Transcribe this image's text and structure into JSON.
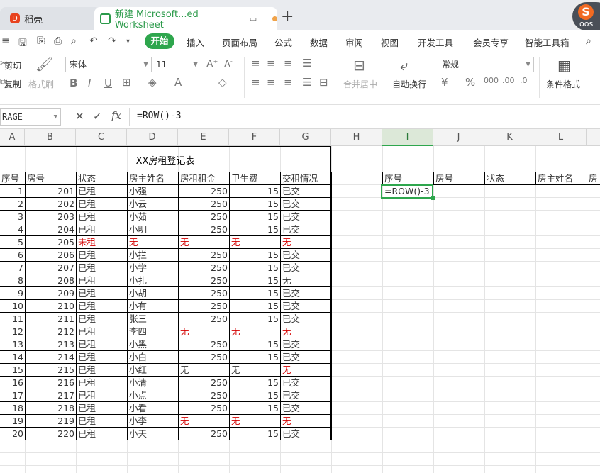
{
  "tabs": [
    {
      "label": "稻壳",
      "active": false
    },
    {
      "label": "新建 Microsoft...ed Worksheet",
      "active": true
    }
  ],
  "menu": {
    "items": [
      "开始",
      "插入",
      "页面布局",
      "公式",
      "数据",
      "审阅",
      "视图",
      "开发工具",
      "会员专享",
      "智能工具箱"
    ],
    "active": "开始"
  },
  "ribbon": {
    "cut": "剪切",
    "paste_fmt": "格式刷",
    "copy": "复制",
    "font_name": "宋体",
    "font_size": "11",
    "merge": "合并居中",
    "wrap": "自动换行",
    "number_format": "常规",
    "cond_format": "条件格式"
  },
  "formula_bar": {
    "name_box": "RAGE",
    "fx": "fx",
    "formula": "=ROW()-3"
  },
  "columns": [
    "A",
    "B",
    "C",
    "D",
    "E",
    "F",
    "G",
    "H",
    "I",
    "J",
    "K",
    "L"
  ],
  "active_column": "I",
  "sheet": {
    "title": "XX房租登记表",
    "headers": [
      "序号",
      "房号",
      "状态",
      "房主姓名",
      "房租租金",
      "卫生费",
      "交租情况"
    ],
    "rows": [
      [
        "1",
        "201",
        "已租",
        "小强",
        "250",
        "15",
        "已交"
      ],
      [
        "2",
        "202",
        "已租",
        "小云",
        "250",
        "15",
        "已交"
      ],
      [
        "3",
        "203",
        "已租",
        "小茹",
        "250",
        "15",
        "已交"
      ],
      [
        "4",
        "204",
        "已租",
        "小明",
        "250",
        "15",
        "已交"
      ],
      [
        "5",
        "205",
        "未租",
        "无",
        "无",
        "无",
        "无"
      ],
      [
        "6",
        "206",
        "已租",
        "小拦",
        "250",
        "15",
        "已交"
      ],
      [
        "7",
        "207",
        "已租",
        "小学",
        "250",
        "15",
        "已交"
      ],
      [
        "8",
        "208",
        "已租",
        "小扎",
        "250",
        "15",
        "无"
      ],
      [
        "9",
        "209",
        "已租",
        "小胡",
        "250",
        "15",
        "已交"
      ],
      [
        "10",
        "210",
        "已租",
        "小有",
        "250",
        "15",
        "已交"
      ],
      [
        "11",
        "211",
        "已租",
        "张三",
        "250",
        "15",
        "已交"
      ],
      [
        "12",
        "212",
        "已租",
        "李四",
        "无",
        "无",
        "无"
      ],
      [
        "13",
        "213",
        "已租",
        "小黑",
        "250",
        "15",
        "已交"
      ],
      [
        "14",
        "214",
        "已租",
        "小白",
        "250",
        "15",
        "已交"
      ],
      [
        "15",
        "215",
        "已租",
        "小红",
        "无",
        "无",
        "无"
      ],
      [
        "16",
        "216",
        "已租",
        "小清",
        "250",
        "15",
        "已交"
      ],
      [
        "17",
        "217",
        "已租",
        "小点",
        "250",
        "15",
        "已交"
      ],
      [
        "18",
        "218",
        "已租",
        "小看",
        "250",
        "15",
        "已交"
      ],
      [
        "19",
        "219",
        "已租",
        "小李",
        "无",
        "无",
        "无"
      ],
      [
        "20",
        "220",
        "已租",
        "小天",
        "250",
        "15",
        "已交"
      ]
    ],
    "red_cells": [
      {
        "row": 5,
        "cols": [
          2,
          3,
          4,
          5,
          6
        ]
      },
      {
        "row": 12,
        "cols": [
          4,
          5,
          6
        ]
      },
      {
        "row": 15,
        "cols": [
          6
        ]
      },
      {
        "row": 19,
        "cols": [
          4,
          5,
          6
        ]
      }
    ],
    "right_headers": [
      "序号",
      "房号",
      "状态",
      "房主姓名",
      "房"
    ],
    "active_cell_value": "=ROW()-3"
  },
  "colors": {
    "accent": "#2ea64d",
    "red_text": "#d40000"
  }
}
